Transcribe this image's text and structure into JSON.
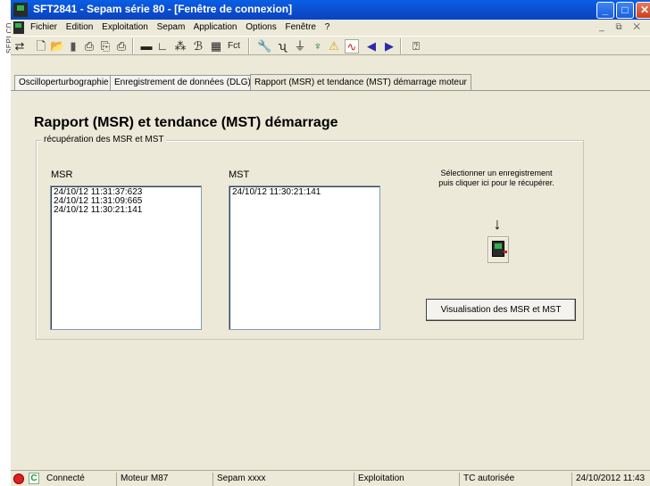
{
  "left_strip": {
    "text": "SEPLCD"
  },
  "window": {
    "title": "SFT2841 - Sepam série 80 - [Fenêtre de connexion]",
    "buttons": {
      "minimize": "_",
      "maximize": "□",
      "close": "✕"
    }
  },
  "menu": {
    "items": [
      "Fichier",
      "Edition",
      "Exploitation",
      "Sepam",
      "Application",
      "Options",
      "Fenêtre",
      "?"
    ],
    "mdi": "_ ⧉ ✕"
  },
  "toolbar": {
    "icons": [
      "connect-icon",
      "new-icon",
      "open-icon",
      "save-icon",
      "print-icon",
      "print-preview-icon",
      "print-setup-icon",
      "save-device-icon",
      "chart-icon",
      "network-icon",
      "function-icon",
      "grid-icon",
      "fct-icon",
      "wrench-icon",
      "tuning-fork-icon",
      "circuit-icon",
      "tree-icon",
      "warning-icon",
      "waveform-icon",
      "back-icon",
      "forward-icon",
      "help-icon"
    ],
    "fct_label": "Fct"
  },
  "tabs": [
    {
      "label": "Oscilloperturbographie"
    },
    {
      "label": "Enregistrement de données (DLG)"
    },
    {
      "label": "Rapport (MSR) et tendance (MST) démarrage moteur"
    }
  ],
  "content": {
    "heading": "Rapport (MSR) et tendance (MST) démarrage",
    "group_label": "récupération des MSR et MST",
    "msr": {
      "label": "MSR",
      "items": [
        "24/10/12  11:31:37:623",
        "24/10/12  11:31:09:665",
        "24/10/12  11:30:21:141"
      ]
    },
    "mst": {
      "label": "MST",
      "items": [
        "24/10/12  11:30:21:141"
      ]
    },
    "instruction_line1": "Sélectionner un enregistrement",
    "instruction_line2": "puis cliquer ici pour le récupérer.",
    "view_button": "Visualisation des MSR et MST"
  },
  "status": {
    "connection": "Connecté",
    "motor": "Moteur M87",
    "sepam": "Sepam xxxx",
    "mode": "Exploitation",
    "tc": "TC autorisée",
    "datetime": "24/10/2012 11:43"
  },
  "colors": {
    "title_bar": "#0a5ee6",
    "window_bg": "#ece9d8",
    "status_led": "#e02020",
    "connected_icon": "#1a9a2a"
  }
}
